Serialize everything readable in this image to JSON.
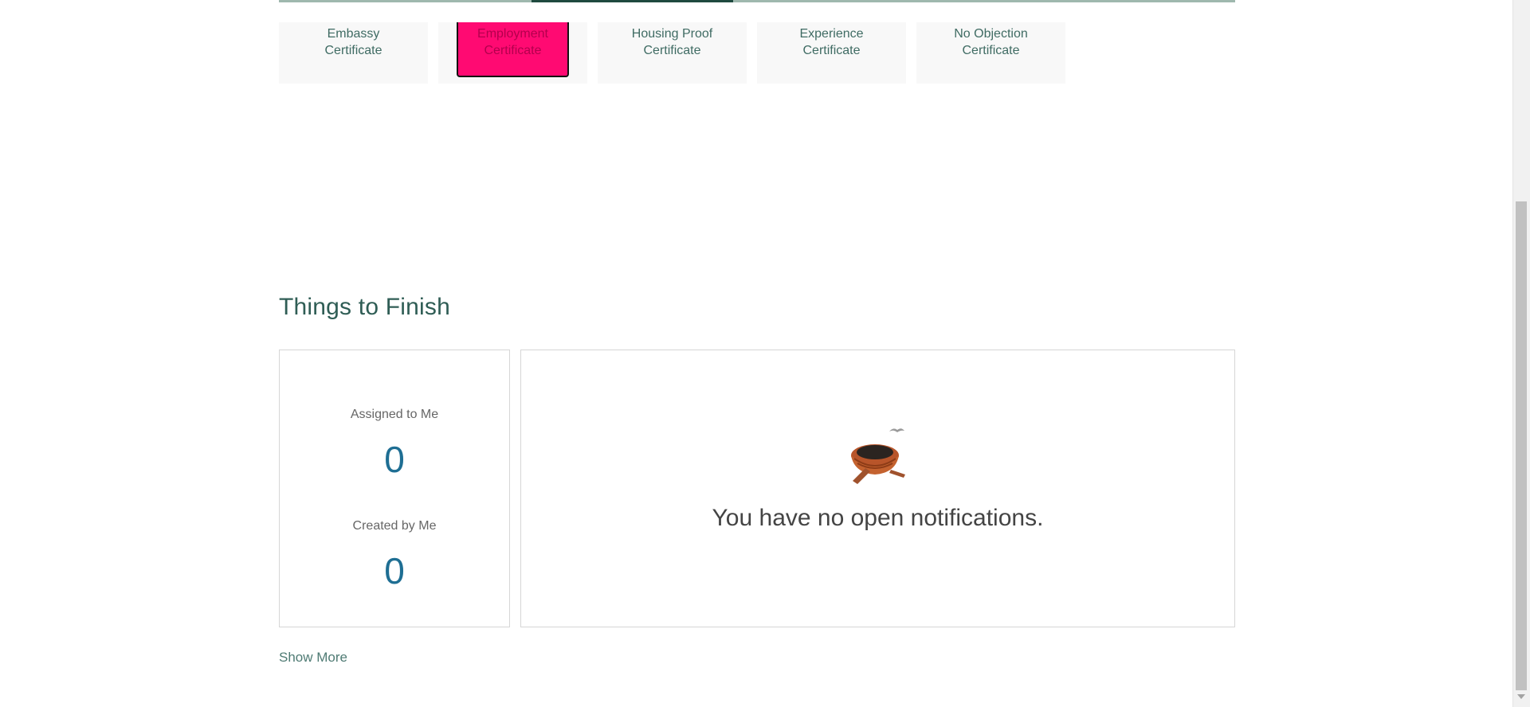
{
  "tiles": [
    {
      "label": "Embassy\nCertificate"
    },
    {
      "label": "Employment\nCertificate"
    },
    {
      "label": "Housing Proof\nCertificate"
    },
    {
      "label": "Experience\nCertificate"
    },
    {
      "label": "No Objection\nCertificate"
    }
  ],
  "things_to_finish": {
    "title": "Things to Finish",
    "assigned_label": "Assigned to Me",
    "assigned_count": "0",
    "created_label": "Created by Me",
    "created_count": "0",
    "empty_message": "You have no open notifications.",
    "show_more": "Show More"
  },
  "colors": {
    "accent": "#2f5d55",
    "focus_highlight": "#ff0a72",
    "count_blue": "#1e6e93"
  },
  "icons": {
    "empty_state": "nest-icon"
  }
}
